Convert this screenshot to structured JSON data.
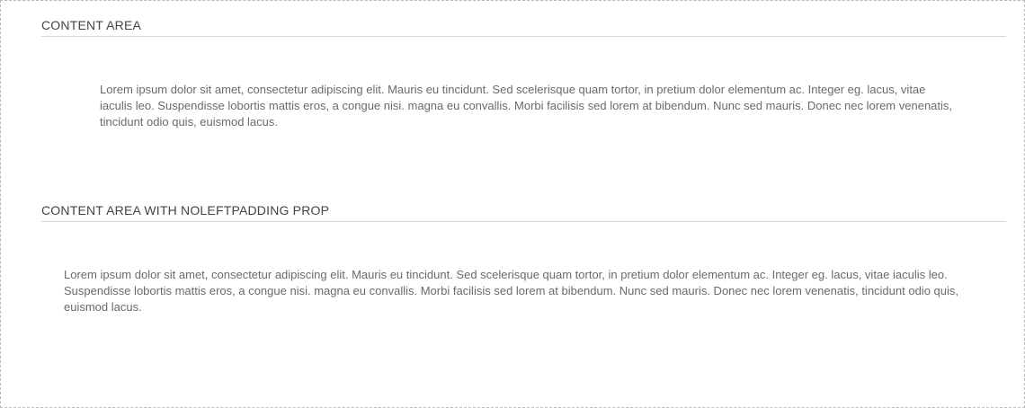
{
  "sections": [
    {
      "header": "CONTENT AREA",
      "body": "Lorem ipsum dolor sit amet, consectetur adipiscing elit. Mauris eu tincidunt. Sed scelerisque quam tortor, in pretium dolor elementum ac. Integer eg. lacus, vitae iaculis leo. Suspendisse lobortis mattis eros, a congue nisi. magna eu convallis. Morbi facilisis sed lorem at bibendum. Nunc sed mauris. Donec nec lorem venenatis, tincidunt odio quis, euismod lacus."
    },
    {
      "header": "CONTENT AREA WITH NOLEFTPADDING PROP",
      "body": "Lorem ipsum dolor sit amet, consectetur adipiscing elit. Mauris eu tincidunt. Sed scelerisque quam tortor, in pretium dolor elementum ac. Integer eg. lacus, vitae iaculis leo. Suspendisse lobortis mattis eros, a congue nisi. magna eu convallis. Morbi facilisis sed lorem at bibendum. Nunc sed mauris. Donec nec lorem venenatis, tincidunt odio quis, euismod lacus."
    }
  ]
}
